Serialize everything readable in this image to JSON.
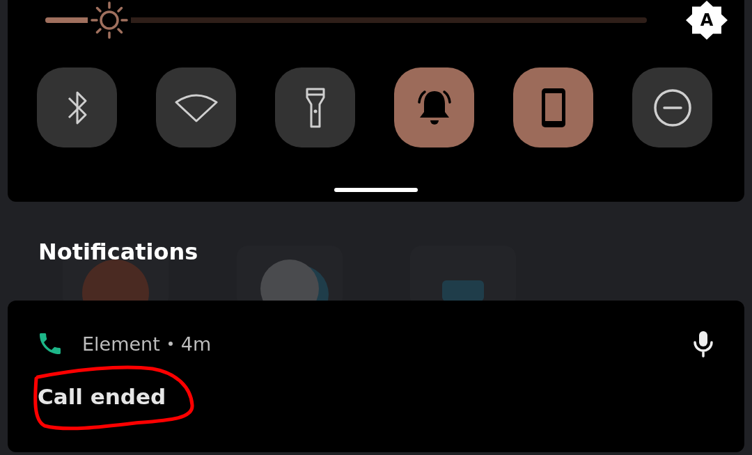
{
  "brightness": {
    "level": 0.106,
    "auto_label": "A"
  },
  "tiles": [
    {
      "kind": "bluetooth",
      "on": false
    },
    {
      "kind": "wifi",
      "on": false
    },
    {
      "kind": "flashlight",
      "on": false
    },
    {
      "kind": "sound",
      "on": true
    },
    {
      "kind": "rotation",
      "on": true
    },
    {
      "kind": "dnd",
      "on": false
    }
  ],
  "notifications": {
    "title": "Notifications",
    "items": [
      {
        "app": "Element",
        "time": "4m",
        "text": "Call ended"
      }
    ]
  }
}
